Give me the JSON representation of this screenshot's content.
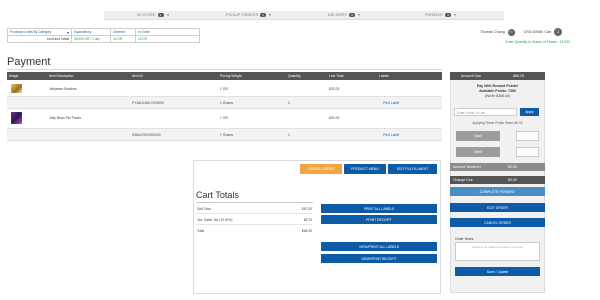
{
  "nav": {
    "items": [
      {
        "label": "IN STORE",
        "count": "2"
      },
      {
        "label": "PICKUP ORDERS",
        "count": "0"
      },
      {
        "label": "DELIVERY",
        "count": "0"
      },
      {
        "label": "PAYMENT",
        "count": "0"
      }
    ]
  },
  "limits": {
    "select_label": "Purchase Limits By Category",
    "headers": [
      "Equivalency",
      "Ordered",
      "In Order"
    ],
    "row_label": "Limit and Totals",
    "equivalency": "28,000 GR / 1 day",
    "ordered": "14 GR",
    "in_order": "14 GR"
  },
  "user": {
    "name": "Thomas Chang",
    "crd": "CRD.00068: Cart",
    "cart_count": "2",
    "order_qty": "Order Quantity in Grams of Flower : 14.000"
  },
  "page_title": "Payment",
  "table": {
    "headers": [
      "Image",
      "Item Description",
      "Item ID",
      "Pricing Weight",
      "Quantity",
      "Line Total",
      "Labels"
    ],
    "products": [
      {
        "description": "Jellybean Buddies",
        "pricing_weight": "2 GR",
        "line_total": "$32.00",
        "sub": {
          "item_id": "FYJALIUWL7003092",
          "weight": "1 Grams",
          "quantity": "2",
          "label": "Print Label"
        }
      },
      {
        "description": "Jelly Bean Per Packs",
        "pricing_weight": "7 GR",
        "line_total": "$30.00",
        "sub": {
          "item_id": "S36ULSEX000018",
          "weight": "7 Grams",
          "quantity": "1",
          "label": "Print Label"
        }
      }
    ]
  },
  "actions": {
    "cancel_order": "CANCEL ORDER",
    "product_menu": "PRODUCT MENU",
    "edit_fulfillment": "EDIT FULFILLMENT",
    "print_all_labels": "PRINT ALL LABELS",
    "print_receipt": "PRINT RECEIPT",
    "view_print_all_labels": "VIEW/PRINT ALL LABELS",
    "view_print_receipt": "VIEW/PRINT RECEIPT"
  },
  "cart_totals": {
    "title": "Cart Totals",
    "rows": [
      {
        "label": "Sub Total",
        "value": "$57.00"
      },
      {
        "label": "Tax: Sales Tax (15.00%)",
        "value": "$8.75"
      },
      {
        "label": "Total",
        "value": "$66.25"
      }
    ]
  },
  "payment_panel": {
    "amount_due_label": "Amount Due",
    "amount_due": "$66.25",
    "reward_title": "Pay With Reward Points!",
    "available_points": "Available Points: 7380",
    "points_worth": "(Worth $368.40)",
    "points_placeholder": "Enter Points To Use",
    "apply": "Apply",
    "applying": "Applying These Points Saves $0.00",
    "cash": "Cash",
    "debit": "Debit",
    "amount_tendered_label": "Amount Tendered",
    "amount_tendered": "$0.00",
    "change_due_label": "Change Due",
    "change_due": "$0.00",
    "complete_payment": "COMPLETE PAYMENT",
    "edit_order": "EDIT ORDER",
    "cancel_order": "CANCEL ORDER",
    "order_notes_label": "Order Notes",
    "notes_placeholder": "Notes to be added to bottom of receipt",
    "save_update": "Save / Update"
  },
  "colors": {
    "primary_blue": "#0d5aa7",
    "orange": "#f0a541",
    "dark_header": "#555555",
    "green": "#2b9a3b"
  }
}
